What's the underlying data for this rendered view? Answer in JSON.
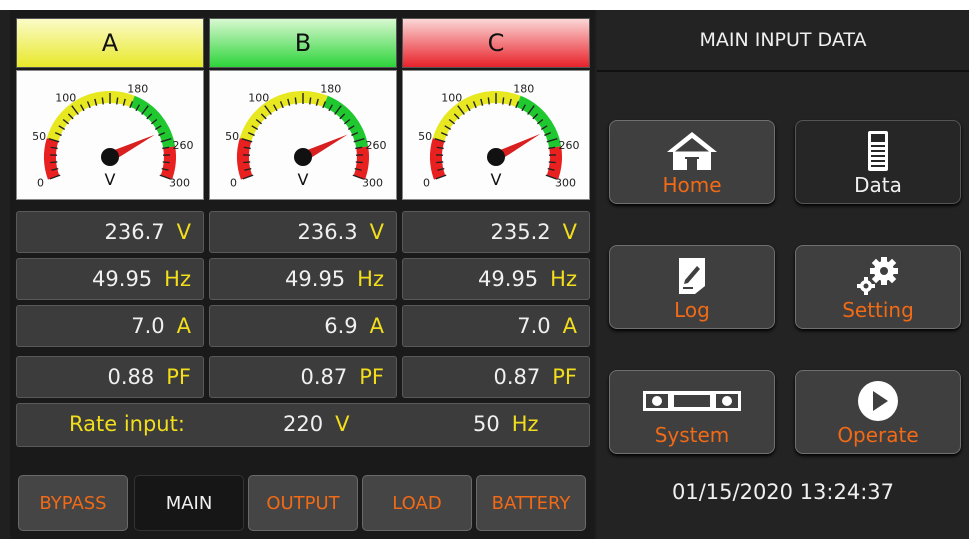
{
  "phases": [
    {
      "name": "A",
      "voltage": "236.7",
      "frequency": "49.95",
      "current": "7.0",
      "power_factor": "0.88"
    },
    {
      "name": "B",
      "voltage": "236.3",
      "frequency": "49.95",
      "current": "6.9",
      "power_factor": "0.87"
    },
    {
      "name": "C",
      "voltage": "235.2",
      "frequency": "49.95",
      "current": "7.0",
      "power_factor": "0.87"
    }
  ],
  "units": {
    "voltage": "V",
    "frequency": "Hz",
    "current": "A",
    "power_factor": "PF"
  },
  "gauge": {
    "unit": "V",
    "ticks": [
      "0",
      "50",
      "100",
      "180",
      "260",
      "300"
    ],
    "min": 0,
    "max": 300,
    "zones": [
      {
        "from": 0,
        "to": 50,
        "color": "#e82020"
      },
      {
        "from": 50,
        "to": 100,
        "color": "#e8e820"
      },
      {
        "from": 100,
        "to": 180,
        "color": "#e8e820"
      },
      {
        "from": 180,
        "to": 260,
        "color": "#20c830"
      },
      {
        "from": 260,
        "to": 300,
        "color": "#e82020"
      }
    ]
  },
  "rate_input": {
    "label": "Rate input:",
    "voltage": "220",
    "voltage_unit": "V",
    "frequency": "50",
    "frequency_unit": "Hz"
  },
  "tabs": [
    {
      "label": "BYPASS",
      "active": false
    },
    {
      "label": "MAIN",
      "active": true
    },
    {
      "label": "OUTPUT",
      "active": false
    },
    {
      "label": "LOAD",
      "active": false
    },
    {
      "label": "BATTERY",
      "active": false
    }
  ],
  "panel": {
    "title": "MAIN INPUT DATA",
    "buttons": {
      "home": {
        "label": "Home",
        "icon": "home-icon"
      },
      "data": {
        "label": "Data",
        "icon": "data-icon"
      },
      "log": {
        "label": "Log",
        "icon": "log-icon"
      },
      "setting": {
        "label": "Setting",
        "icon": "gear-icon"
      },
      "system": {
        "label": "System",
        "icon": "system-icon"
      },
      "operate": {
        "label": "Operate",
        "icon": "play-icon"
      }
    },
    "datetime": "01/15/2020  13:24:37"
  },
  "colors": {
    "accent_orange": "#f16a16",
    "unit_yellow": "#f3de1c",
    "phase_a": "#e8e82a",
    "phase_b": "#2dd43a",
    "phase_c": "#e8222a"
  }
}
